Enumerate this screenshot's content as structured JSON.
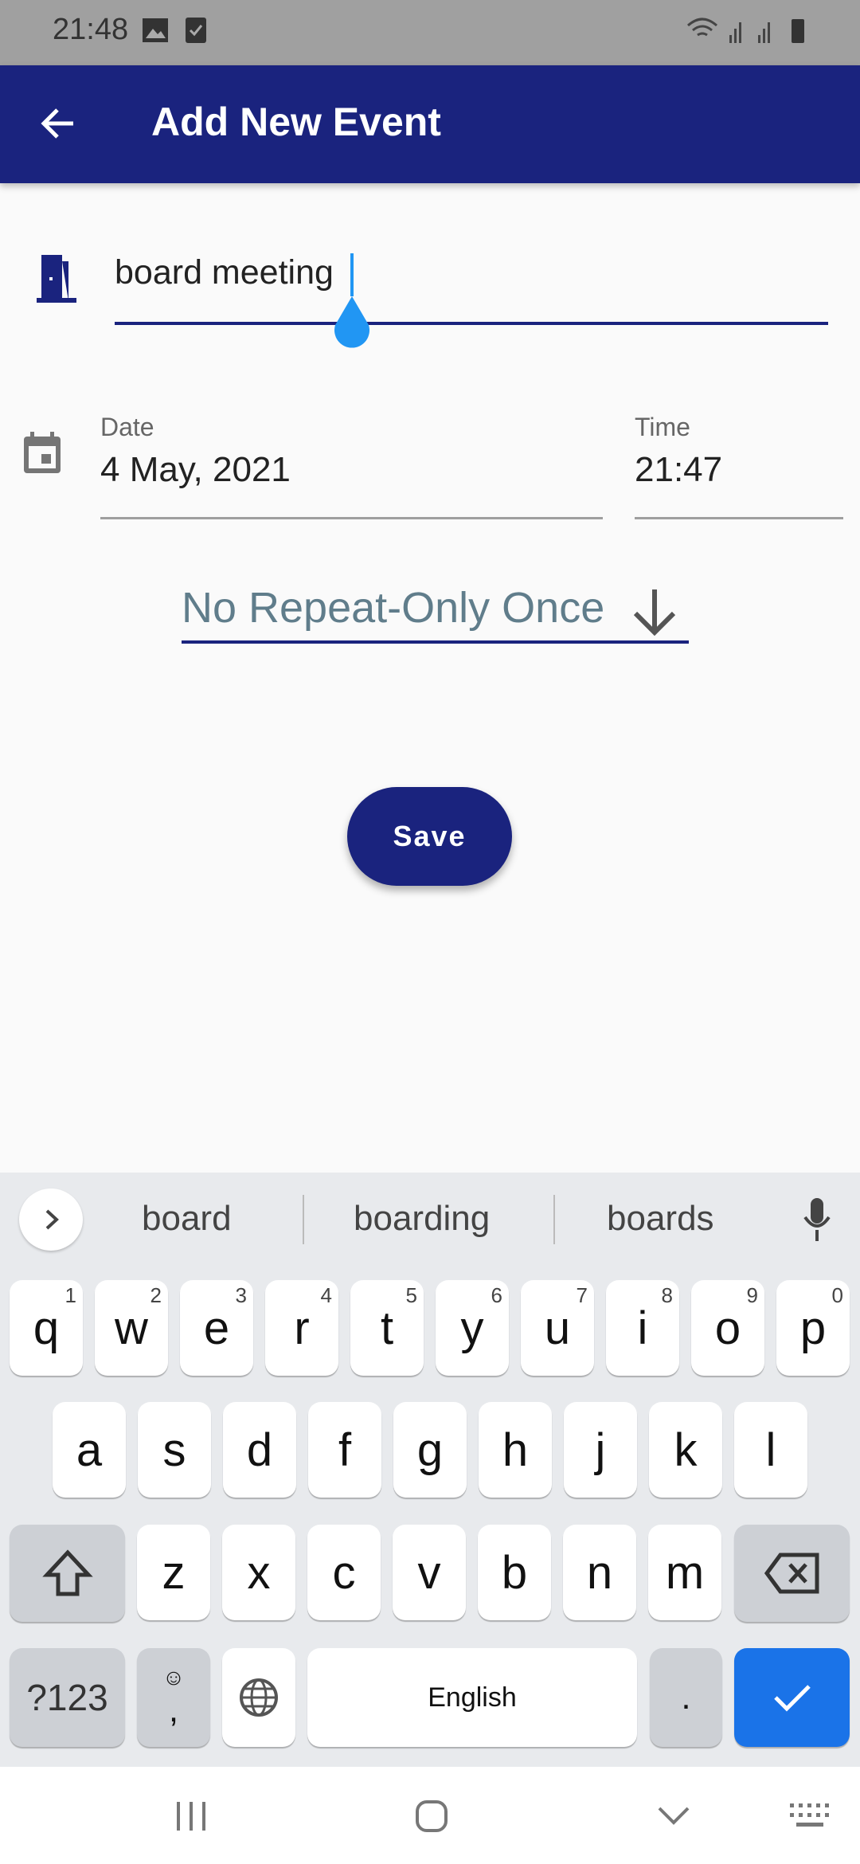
{
  "status_bar": {
    "time": "21:48"
  },
  "app_bar": {
    "title": "Add New Event",
    "back_icon": "arrow-back-icon"
  },
  "form": {
    "event_name": "board meeting",
    "date_label": "Date",
    "date_value": "4 May, 2021",
    "time_label": "Time",
    "time_value": "21:47",
    "repeat_value": "No Repeat-Only Once",
    "save_label": "Save"
  },
  "colors": {
    "primary": "#1a237e",
    "accent": "#2196f3",
    "repeat_text": "#607d8b"
  },
  "keyboard": {
    "suggestions": [
      "board",
      "boarding",
      "boards"
    ],
    "row1": [
      {
        "k": "q",
        "n": "1"
      },
      {
        "k": "w",
        "n": "2"
      },
      {
        "k": "e",
        "n": "3"
      },
      {
        "k": "r",
        "n": "4"
      },
      {
        "k": "t",
        "n": "5"
      },
      {
        "k": "y",
        "n": "6"
      },
      {
        "k": "u",
        "n": "7"
      },
      {
        "k": "i",
        "n": "8"
      },
      {
        "k": "o",
        "n": "9"
      },
      {
        "k": "p",
        "n": "0"
      }
    ],
    "row2": [
      "a",
      "s",
      "d",
      "f",
      "g",
      "h",
      "j",
      "k",
      "l"
    ],
    "row3": [
      "z",
      "x",
      "c",
      "v",
      "b",
      "n",
      "m"
    ],
    "symbols_label": "?123",
    "comma_label": ",",
    "space_label": "English",
    "period_label": "."
  }
}
